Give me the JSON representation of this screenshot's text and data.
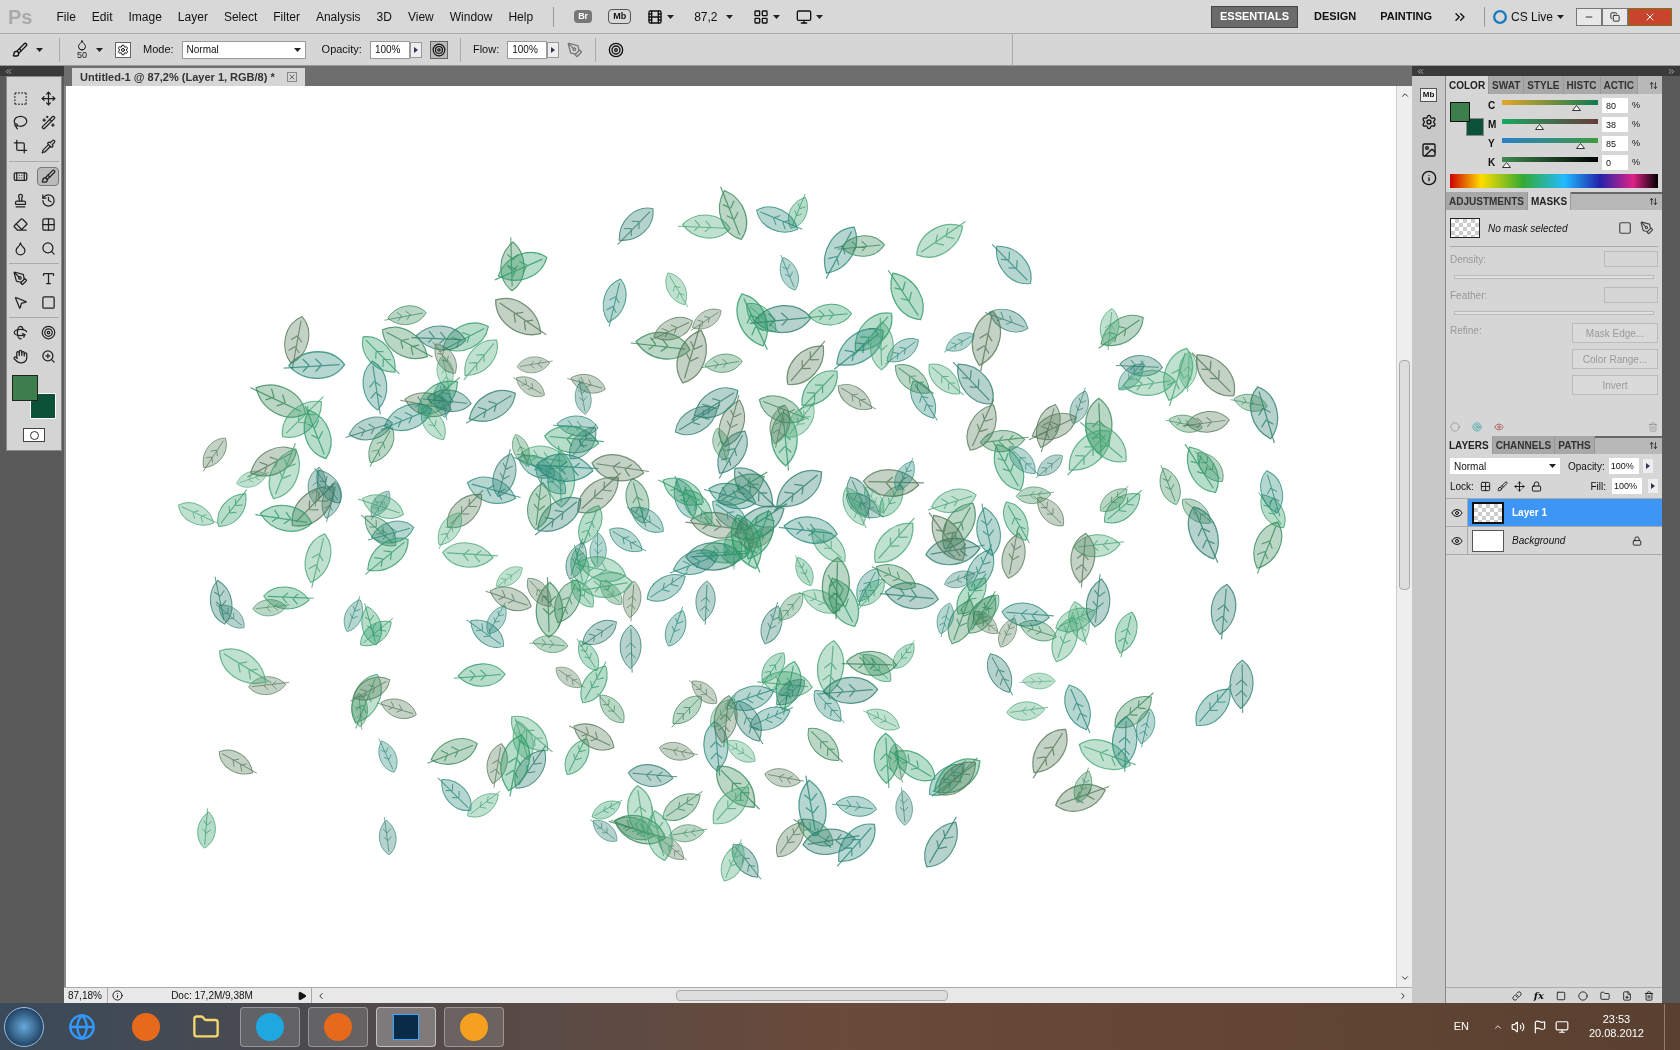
{
  "app_logo": "Ps",
  "menu": [
    "File",
    "Edit",
    "Image",
    "Layer",
    "Select",
    "Filter",
    "Analysis",
    "3D",
    "View",
    "Window",
    "Help"
  ],
  "app_bar": {
    "bridge": "Br",
    "mini_bridge": "Mb",
    "zoom": "87,2"
  },
  "workspaces": [
    {
      "label": "ESSENTIALS",
      "selected": true
    },
    {
      "label": "DESIGN",
      "selected": false
    },
    {
      "label": "PAINTING",
      "selected": false
    }
  ],
  "cs_live": "CS Live",
  "options": {
    "brush_size": "50",
    "mode_label": "Mode:",
    "mode": "Normal",
    "opacity_label": "Opacity:",
    "opacity": "100%",
    "flow_label": "Flow:",
    "flow": "100%"
  },
  "document_tab": "Untitled-1 @ 87,2% (Layer 1, RGB/8) *",
  "panel_dock": {
    "mini_bridge": "Mb"
  },
  "color_panel": {
    "tabs": [
      {
        "label": "COLOR",
        "selected": true
      },
      {
        "label": "SWAT",
        "selected": false
      },
      {
        "label": "STYLE",
        "selected": false
      },
      {
        "label": "HISTC",
        "selected": false
      },
      {
        "label": "ACTIC",
        "selected": false
      }
    ],
    "sliders": [
      {
        "label": "C",
        "value": "80",
        "unit": "%",
        "level": 0.8
      },
      {
        "label": "M",
        "value": "38",
        "unit": "%",
        "level": 0.38
      },
      {
        "label": "Y",
        "value": "85",
        "unit": "%",
        "level": 0.85
      },
      {
        "label": "K",
        "value": "0",
        "unit": "%",
        "level": 0
      }
    ]
  },
  "masks_panel": {
    "tabs": [
      {
        "label": "ADJUSTMENTS",
        "selected": false
      },
      {
        "label": "MASKS",
        "selected": true
      }
    ],
    "status": "No mask selected",
    "density_label": "Density:",
    "feather_label": "Feather:",
    "refine_label": "Refine:",
    "buttons": [
      {
        "label": "Mask Edge...",
        "disabled": true
      },
      {
        "label": "Color Range...",
        "disabled": true
      },
      {
        "label": "Invert",
        "disabled": true
      }
    ]
  },
  "layers_panel": {
    "tabs": [
      {
        "label": "LAYERS",
        "selected": true
      },
      {
        "label": "CHANNELS",
        "selected": false
      },
      {
        "label": "PATHS",
        "selected": false
      }
    ],
    "blend_mode": "Normal",
    "opacity_label": "Opacity:",
    "opacity": "100%",
    "lock_label": "Lock:",
    "fill_label": "Fill:",
    "fill": "100%",
    "fx_label": "fx",
    "layers": [
      {
        "name": "Layer 1",
        "kind": "layer",
        "selected": true,
        "visible": true,
        "locked": false
      },
      {
        "name": "Background",
        "kind": "background",
        "selected": false,
        "visible": true,
        "locked": true
      }
    ]
  },
  "status_bar": {
    "zoom": "87,18%",
    "doc": "Doc: 17,2M/9,38M"
  },
  "taskbar": {
    "language": "EN",
    "time": "23:53",
    "date": "20.08.2012"
  }
}
